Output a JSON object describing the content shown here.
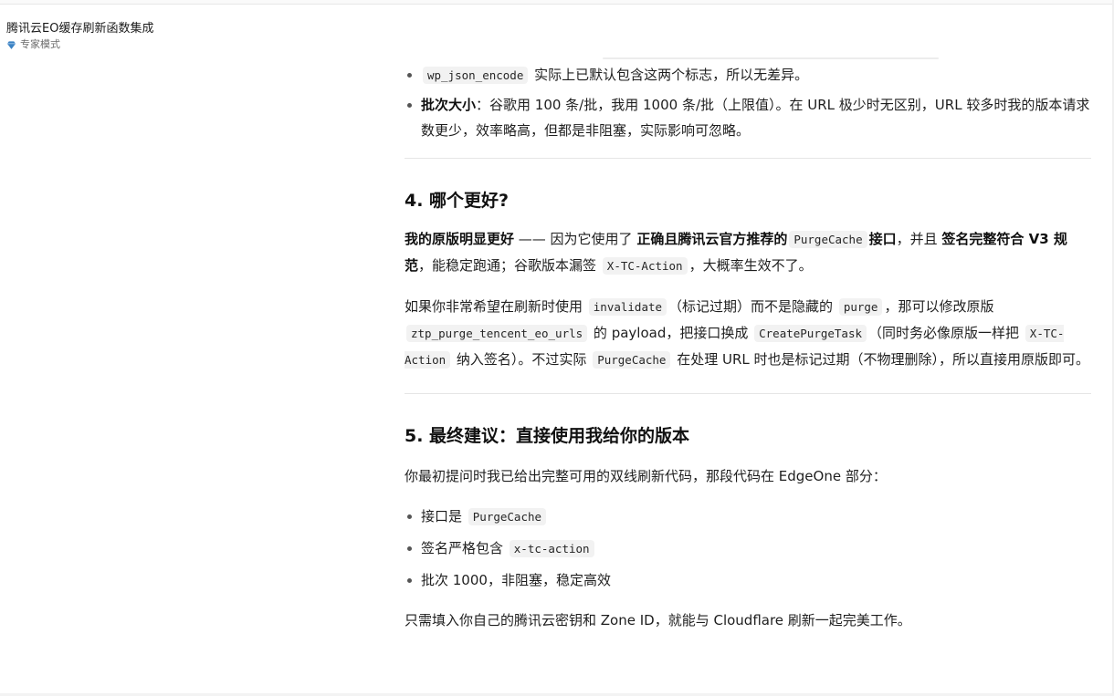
{
  "app": {
    "title": "腾讯云EO缓存刷新函数集成",
    "mode": "专家模式"
  },
  "top_item": {
    "code": "wp_json_encode",
    "text": "实际上已默认包含这两个标志，所以无差异。"
  },
  "batch_item": {
    "bold": "批次大小",
    "text": "：谷歌用 100 条/批，我用 1000 条/批（上限值）。在 URL 极少时无区别，URL 较多时我的版本请求数更少，效率略高，但都是非阻塞，实际影响可忽略。"
  },
  "section4": {
    "heading": "4. 哪个更好?",
    "p1": {
      "b1": "我的原版明显更好",
      "t1": " —— 因为它使用了 ",
      "b2": "正确且腾讯云官方推荐的",
      "code1": "PurgeCache",
      "b3": "接口",
      "t2": "，并且 ",
      "b4": "签名完整符合 V3 规范",
      "t3": "，能稳定跑通；谷歌版本漏签 ",
      "code2": "X-TC-Action",
      "t4": "，大概率生效不了。"
    },
    "p2": {
      "t1": "如果你非常希望在刷新时使用 ",
      "c1": "invalidate",
      "t2": "（标记过期）而不是隐藏的 ",
      "c2": "purge",
      "t3": "，那可以修改原版 ",
      "c3": "ztp_purge_tencent_eo_urls",
      "t4": " 的 payload，把接口换成 ",
      "c4": "CreatePurgeTask",
      "t5": "（同时务必像原版一样把 ",
      "c5": "X-TC-Action",
      "t6": " 纳入签名）。不过实际 ",
      "c6": "PurgeCache",
      "t7": " 在处理 URL 时也是标记过期（不物理删除），所以直接用原版即可。"
    }
  },
  "section5": {
    "heading": "5. 最终建议：直接使用我给你的版本",
    "intro": "你最初提问时我已给出完整可用的双线刷新代码，那段代码在 EdgeOne 部分：",
    "bullets": {
      "b1_text": "接口是 ",
      "b1_code": "PurgeCache",
      "b2_text": "签名严格包含 ",
      "b2_code": "x-tc-action",
      "b3_text": "批次 1000，非阻塞，稳定高效"
    },
    "closing": "只需填入你自己的腾讯云密钥和 Zone ID，就能与 Cloudflare 刷新一起完美工作。"
  },
  "colors": {
    "text": "#1f1f1f",
    "code_bg": "#f2f2f2",
    "gem": "#3b82c4",
    "divider": "#e5e5e5"
  }
}
